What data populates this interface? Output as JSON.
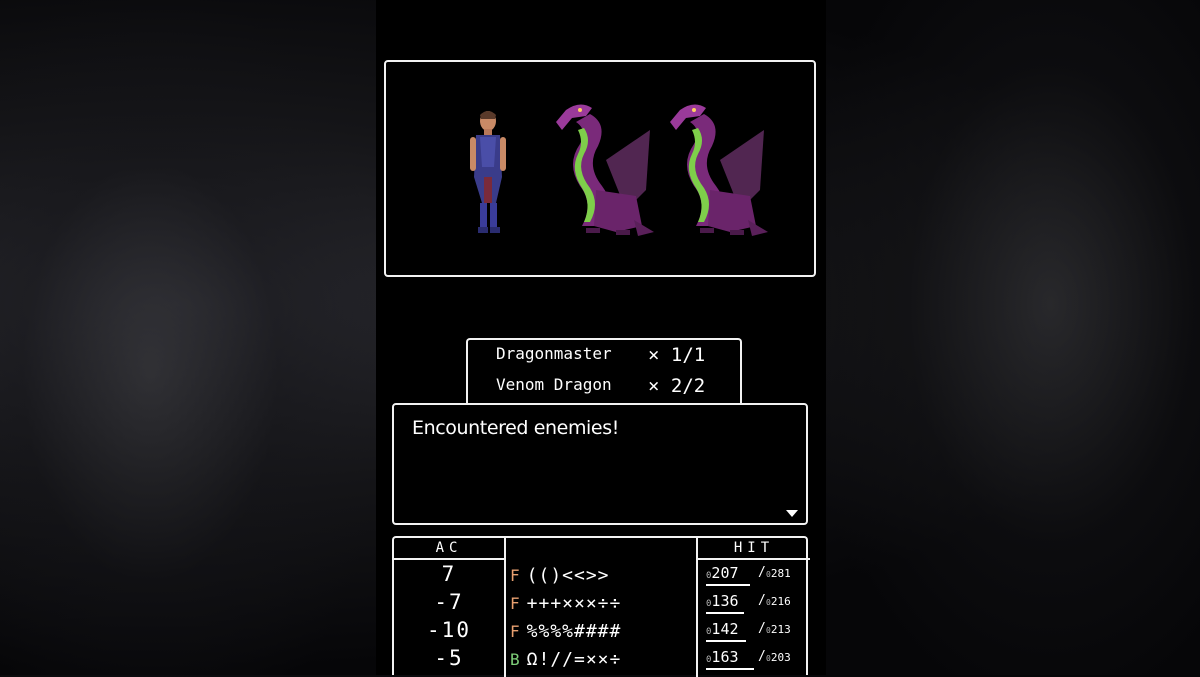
{
  "colors": {
    "border": "#f2f2f2",
    "class_fighter": "#e8a070",
    "class_bishop": "#7fd07a"
  },
  "battle": {
    "sprites": [
      "dragonmaster-sprite",
      "venom-dragon-sprite",
      "venom-dragon-sprite"
    ]
  },
  "enemies": [
    {
      "name": "Dragonmaster",
      "count": "× 1/1"
    },
    {
      "name": "Venom Dragon",
      "count": "× 2/2"
    }
  ],
  "message": {
    "text": "Encountered enemies!",
    "continue_icon": "down-triangle-icon"
  },
  "party": {
    "ac_header": "AC",
    "hit_header": "HIT",
    "members": [
      {
        "ac": "7",
        "class": "F",
        "name": "(()<<>>",
        "hp": "207",
        "hp_max": "281",
        "hp_frac": 0.74
      },
      {
        "ac": "-7",
        "class": "F",
        "name": "+++×××÷÷",
        "hp": "136",
        "hp_max": "216",
        "hp_frac": 0.63
      },
      {
        "ac": "-10",
        "class": "F",
        "name": "%%%%####",
        "hp": "142",
        "hp_max": "213",
        "hp_frac": 0.67
      },
      {
        "ac": "-5",
        "class": "B",
        "name": "Ω!//=××÷",
        "hp": "163",
        "hp_max": "203",
        "hp_frac": 0.8
      }
    ]
  }
}
